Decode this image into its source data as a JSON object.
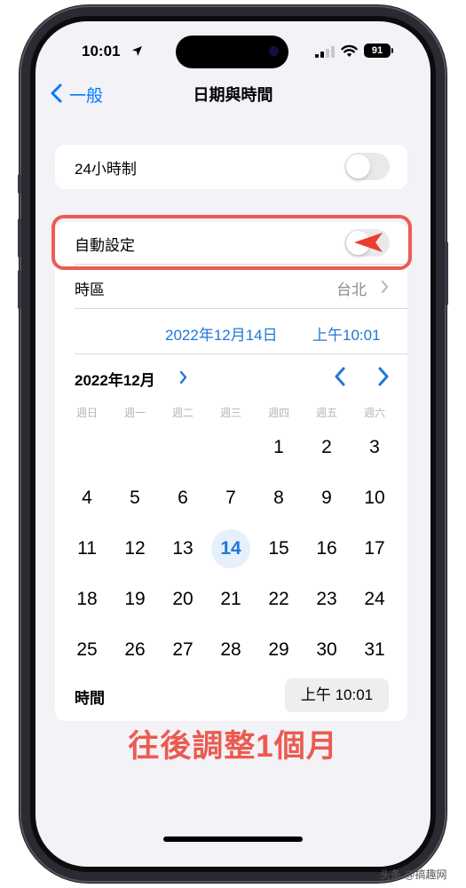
{
  "status_bar": {
    "time": "10:01",
    "battery": "91"
  },
  "nav": {
    "back_label": "一般",
    "title": "日期與時間"
  },
  "settings": {
    "hour24_label": "24小時制",
    "hour24_on": false,
    "auto_set_label": "自動設定",
    "auto_set_on": false,
    "timezone_label": "時區",
    "timezone_value": "台北",
    "selected_date": "2022年12月14日",
    "selected_time": "上午10:01"
  },
  "calendar": {
    "month_title": "2022年12月",
    "weekdays": [
      "週日",
      "週一",
      "週二",
      "週三",
      "週四",
      "週五",
      "週六"
    ],
    "first_weekday_index": 4,
    "days_in_month": 31,
    "today": 14
  },
  "time_row": {
    "label": "時間",
    "value": "上午 10:01"
  },
  "annotation": "往後調整1個月",
  "watermark": "头条 @搞趣网",
  "colors": {
    "accent": "#1f77d8",
    "highlight": "#ee5b52",
    "background": "#f2f2f7"
  }
}
